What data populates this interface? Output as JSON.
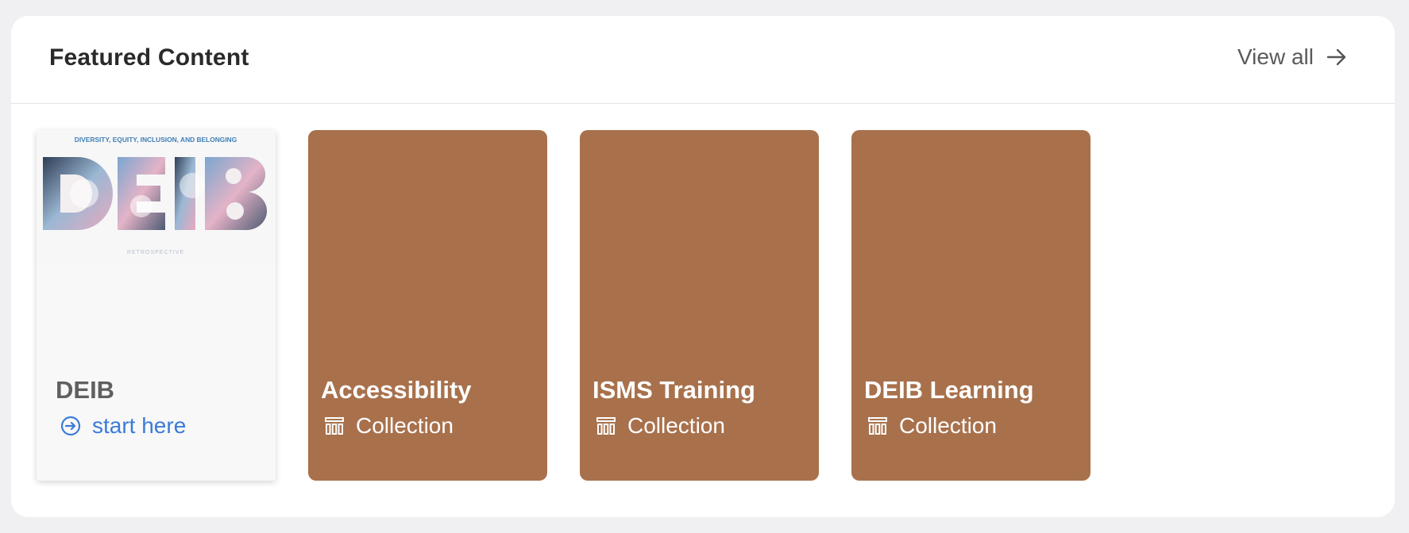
{
  "section": {
    "title": "Featured Content",
    "view_all_label": "View all"
  },
  "cards": [
    {
      "title": "DEIB",
      "action_label": "start here",
      "image": {
        "top_text": "DIVERSITY, EQUITY, INCLUSION, AND BELONGING",
        "main_text": "DEIB",
        "bottom_text": "RETROSPECTIVE"
      }
    },
    {
      "title": "Accessibility",
      "type_label": "Collection"
    },
    {
      "title": "ISMS Training",
      "type_label": "Collection"
    },
    {
      "title": "DEIB Learning",
      "type_label": "Collection"
    }
  ],
  "colors": {
    "card_brown": "#a8714c",
    "link_blue": "#3b7bd8",
    "page_background": "#f0f0f2"
  },
  "icons": {
    "view_all": "arrow-right-icon",
    "start_here": "arrow-circle-right-icon",
    "collection": "collection-icon"
  }
}
